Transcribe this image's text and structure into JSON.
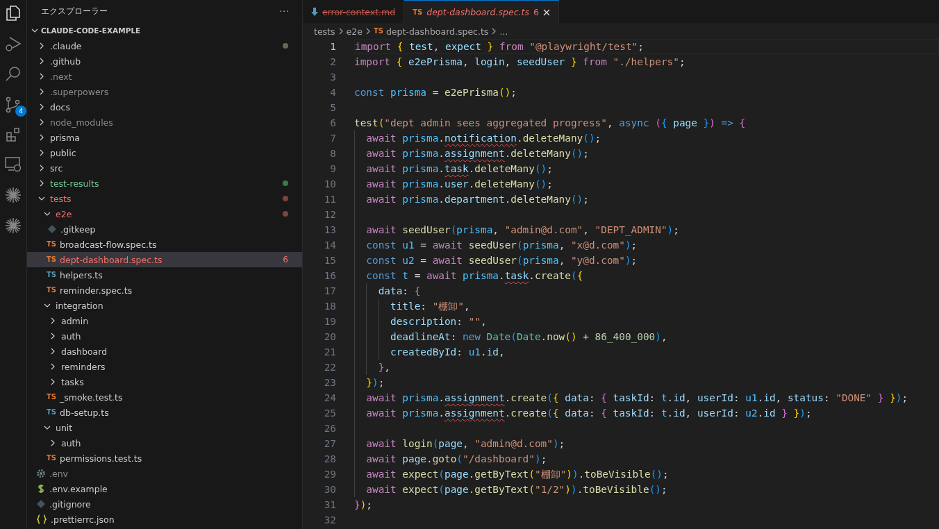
{
  "activity_bar": {
    "items": [
      {
        "kind": "explorer",
        "selected": true
      },
      {
        "kind": "debug",
        "selected": false
      },
      {
        "kind": "search",
        "selected": false
      },
      {
        "kind": "scm",
        "selected": false,
        "badge": "4"
      },
      {
        "kind": "extensions",
        "selected": false
      },
      {
        "kind": "remote",
        "selected": false
      },
      {
        "kind": "spark",
        "selected": false
      },
      {
        "kind": "spark",
        "selected": false
      }
    ]
  },
  "sidebar": {
    "title": "エクスプローラー",
    "more": "···",
    "root": {
      "label": "CLAUDE-CODE-EXAMPLE",
      "expanded": true
    },
    "items": [
      {
        "label": ".claude",
        "kind": "folder",
        "expanded": false,
        "selected": false,
        "decoration": {
          "color": "#6f6457"
        }
      },
      {
        "label": ".github",
        "kind": "folder",
        "expanded": false,
        "selected": false
      },
      {
        "label": ".next",
        "kind": "folder",
        "expanded": false,
        "selected": false,
        "color": "#8c8c8c"
      },
      {
        "label": ".superpowers",
        "kind": "folder",
        "expanded": false,
        "selected": false,
        "color": "#8c8c8c"
      },
      {
        "label": "docs",
        "kind": "folder",
        "expanded": false,
        "selected": false
      },
      {
        "label": "node_modules",
        "kind": "folder",
        "expanded": false,
        "selected": false,
        "color": "#8c8c8c"
      },
      {
        "label": "prisma",
        "kind": "folder",
        "expanded": false,
        "selected": false
      },
      {
        "label": "public",
        "kind": "folder",
        "expanded": false,
        "selected": false
      },
      {
        "label": "src",
        "kind": "folder",
        "expanded": false,
        "selected": false
      },
      {
        "label": "test-results",
        "kind": "folder",
        "expanded": false,
        "selected": false,
        "color": "#73c991",
        "decoration": {
          "color": "#3c7a4c"
        }
      },
      {
        "label": "tests",
        "kind": "folder",
        "expanded": true,
        "selected": false,
        "color": "#f2706a",
        "decoration": {
          "color": "#7a4540"
        },
        "children": [
          {
            "label": "e2e",
            "kind": "folder",
            "expanded": true,
            "selected": false,
            "color": "#f2706a",
            "decoration": {
              "color": "#7a4540"
            },
            "children": [
              {
                "label": ".gitkeep",
                "kind": "git",
                "selected": false
              },
              {
                "label": "broadcast-flow.spec.ts",
                "kind": "ts-test",
                "icon": "TS",
                "selected": false
              },
              {
                "label": "dept-dashboard.spec.ts",
                "kind": "ts-test",
                "icon": "TS",
                "selected": true,
                "color": "#f2706a",
                "badge": "6"
              },
              {
                "label": "helpers.ts",
                "kind": "ts",
                "icon": "TS",
                "selected": false
              },
              {
                "label": "reminder.spec.ts",
                "kind": "ts-test",
                "icon": "TS",
                "selected": false
              }
            ]
          },
          {
            "label": "integration",
            "kind": "folder",
            "expanded": true,
            "selected": false,
            "children": [
              {
                "label": "admin",
                "kind": "folder",
                "expanded": false,
                "selected": false
              },
              {
                "label": "auth",
                "kind": "folder",
                "expanded": false,
                "selected": false
              },
              {
                "label": "dashboard",
                "kind": "folder",
                "expanded": false,
                "selected": false
              },
              {
                "label": "reminders",
                "kind": "folder",
                "expanded": false,
                "selected": false
              },
              {
                "label": "tasks",
                "kind": "folder",
                "expanded": false,
                "selected": false
              },
              {
                "label": "_smoke.test.ts",
                "kind": "ts-test",
                "icon": "TS",
                "selected": false
              },
              {
                "label": "db-setup.ts",
                "kind": "ts",
                "icon": "TS",
                "selected": false
              }
            ]
          },
          {
            "label": "unit",
            "kind": "folder",
            "expanded": true,
            "selected": false,
            "children": [
              {
                "label": "auth",
                "kind": "folder",
                "expanded": false,
                "selected": false
              },
              {
                "label": "permissions.test.ts",
                "kind": "ts-test",
                "icon": "TS",
                "selected": false
              }
            ]
          }
        ]
      },
      {
        "label": ".env",
        "kind": "gear",
        "selected": false,
        "color": "#8c8c8c"
      },
      {
        "label": ".env.example",
        "kind": "env",
        "selected": false
      },
      {
        "label": ".gitignore",
        "kind": "git",
        "selected": false
      },
      {
        "label": ".prettierrc.json",
        "kind": "json",
        "selected": false
      }
    ]
  },
  "tabs": [
    {
      "label": "error-context.md",
      "kind": "download",
      "selected": false,
      "deleted": true,
      "preview": false
    },
    {
      "label": "dept-dashboard.spec.ts",
      "kind": "ts-test",
      "icon": "TS",
      "selected": true,
      "deleted": false,
      "preview": true,
      "problems": "6"
    }
  ],
  "breadcrumbs": [
    {
      "label": "tests"
    },
    {
      "label": "e2e"
    },
    {
      "label": "dept-dashboard.spec.ts",
      "kind": "ts-test",
      "icon": "TS"
    },
    {
      "label": "..."
    }
  ],
  "editor": {
    "lines": [
      {
        "no": "1",
        "current": true,
        "tokens": [
          {
            "kind": "kw",
            "text": "import"
          },
          {
            "kind": "b1",
            "text": " {"
          },
          {
            "kind": "var",
            "text": " test"
          },
          {
            "kind": "p",
            "text": ", "
          },
          {
            "kind": "var",
            "text": "expect"
          },
          {
            "kind": "b1",
            "text": " }"
          },
          {
            "kind": "kw",
            "text": " from"
          },
          {
            "kind": "str",
            "text": " \"@playwright/test\""
          },
          {
            "kind": "p",
            "text": ";"
          }
        ]
      },
      {
        "no": "2",
        "current": false,
        "tokens": [
          {
            "kind": "kw",
            "text": "import"
          },
          {
            "kind": "b1",
            "text": " {"
          },
          {
            "kind": "var",
            "text": " e2ePrisma"
          },
          {
            "kind": "p",
            "text": ", "
          },
          {
            "kind": "var",
            "text": "login"
          },
          {
            "kind": "p",
            "text": ", "
          },
          {
            "kind": "var",
            "text": "seedUser"
          },
          {
            "kind": "b1",
            "text": " }"
          },
          {
            "kind": "kw",
            "text": " from"
          },
          {
            "kind": "str",
            "text": " \"./helpers\""
          },
          {
            "kind": "p",
            "text": ";"
          }
        ]
      },
      {
        "no": "3",
        "current": false
      },
      {
        "no": "4",
        "current": false,
        "tokens": [
          {
            "kind": "st",
            "text": "const"
          },
          {
            "kind": "const",
            "text": " prisma"
          },
          {
            "kind": "p",
            "text": " = "
          },
          {
            "kind": "fn",
            "text": "e2ePrisma"
          },
          {
            "kind": "b1",
            "text": "()"
          },
          {
            "kind": "p",
            "text": ";"
          }
        ]
      },
      {
        "no": "5",
        "current": false
      },
      {
        "no": "6",
        "current": false,
        "tokens": [
          {
            "kind": "fn",
            "text": "test"
          },
          {
            "kind": "b1",
            "text": "("
          },
          {
            "kind": "str",
            "text": "\"dept admin sees aggregated progress\""
          },
          {
            "kind": "p",
            "text": ", "
          },
          {
            "kind": "st",
            "text": "async"
          },
          {
            "kind": "b2",
            "text": " ("
          },
          {
            "kind": "b3",
            "text": "{"
          },
          {
            "kind": "var",
            "text": " page"
          },
          {
            "kind": "b3",
            "text": " }"
          },
          {
            "kind": "b2",
            "text": ")"
          },
          {
            "kind": "st",
            "text": " =>"
          },
          {
            "kind": "b2",
            "text": " {"
          }
        ]
      },
      {
        "no": "7",
        "current": false,
        "tokens": [
          {
            "kind": "kw",
            "text": "  await"
          },
          {
            "kind": "const",
            "text": " prisma"
          },
          {
            "kind": "p",
            "text": "."
          },
          {
            "kind": "var",
            "text": "notification",
            "squiggle": true
          },
          {
            "kind": "p",
            "text": "."
          },
          {
            "kind": "fn",
            "text": "deleteMany"
          },
          {
            "kind": "b3",
            "text": "()"
          },
          {
            "kind": "p",
            "text": ";"
          }
        ]
      },
      {
        "no": "8",
        "current": false,
        "tokens": [
          {
            "kind": "kw",
            "text": "  await"
          },
          {
            "kind": "const",
            "text": " prisma"
          },
          {
            "kind": "p",
            "text": "."
          },
          {
            "kind": "var",
            "text": "assignment",
            "squiggle": true
          },
          {
            "kind": "p",
            "text": "."
          },
          {
            "kind": "fn",
            "text": "deleteMany"
          },
          {
            "kind": "b3",
            "text": "()"
          },
          {
            "kind": "p",
            "text": ";"
          }
        ]
      },
      {
        "no": "9",
        "current": false,
        "tokens": [
          {
            "kind": "kw",
            "text": "  await"
          },
          {
            "kind": "const",
            "text": " prisma"
          },
          {
            "kind": "p",
            "text": "."
          },
          {
            "kind": "var",
            "text": "task",
            "squiggle": true
          },
          {
            "kind": "p",
            "text": "."
          },
          {
            "kind": "fn",
            "text": "deleteMany"
          },
          {
            "kind": "b3",
            "text": "()"
          },
          {
            "kind": "p",
            "text": ";"
          }
        ]
      },
      {
        "no": "10",
        "current": false,
        "tokens": [
          {
            "kind": "kw",
            "text": "  await"
          },
          {
            "kind": "const",
            "text": " prisma"
          },
          {
            "kind": "p",
            "text": "."
          },
          {
            "kind": "var",
            "text": "user"
          },
          {
            "kind": "p",
            "text": "."
          },
          {
            "kind": "fn",
            "text": "deleteMany"
          },
          {
            "kind": "b3",
            "text": "()"
          },
          {
            "kind": "p",
            "text": ";"
          }
        ]
      },
      {
        "no": "11",
        "current": false,
        "tokens": [
          {
            "kind": "kw",
            "text": "  await"
          },
          {
            "kind": "const",
            "text": " prisma"
          },
          {
            "kind": "p",
            "text": "."
          },
          {
            "kind": "var",
            "text": "department"
          },
          {
            "kind": "p",
            "text": "."
          },
          {
            "kind": "fn",
            "text": "deleteMany"
          },
          {
            "kind": "b3",
            "text": "()"
          },
          {
            "kind": "p",
            "text": ";"
          }
        ]
      },
      {
        "no": "12",
        "current": false
      },
      {
        "no": "13",
        "current": false,
        "tokens": [
          {
            "kind": "kw",
            "text": "  await"
          },
          {
            "kind": "fn",
            "text": " seedUser"
          },
          {
            "kind": "b3",
            "text": "("
          },
          {
            "kind": "const",
            "text": "prisma"
          },
          {
            "kind": "p",
            "text": ", "
          },
          {
            "kind": "str",
            "text": "\"admin@d.com\""
          },
          {
            "kind": "p",
            "text": ", "
          },
          {
            "kind": "str",
            "text": "\"DEPT_ADMIN\""
          },
          {
            "kind": "b3",
            "text": ")"
          },
          {
            "kind": "p",
            "text": ";"
          }
        ]
      },
      {
        "no": "14",
        "current": false,
        "tokens": [
          {
            "kind": "st",
            "text": "  const"
          },
          {
            "kind": "const",
            "text": " u1"
          },
          {
            "kind": "p",
            "text": " = "
          },
          {
            "kind": "kw",
            "text": "await"
          },
          {
            "kind": "fn",
            "text": " seedUser"
          },
          {
            "kind": "b3",
            "text": "("
          },
          {
            "kind": "const",
            "text": "prisma"
          },
          {
            "kind": "p",
            "text": ", "
          },
          {
            "kind": "str",
            "text": "\"x@d.com\""
          },
          {
            "kind": "b3",
            "text": ")"
          },
          {
            "kind": "p",
            "text": ";"
          }
        ]
      },
      {
        "no": "15",
        "current": false,
        "tokens": [
          {
            "kind": "st",
            "text": "  const"
          },
          {
            "kind": "const",
            "text": " u2"
          },
          {
            "kind": "p",
            "text": " = "
          },
          {
            "kind": "kw",
            "text": "await"
          },
          {
            "kind": "fn",
            "text": " seedUser"
          },
          {
            "kind": "b3",
            "text": "("
          },
          {
            "kind": "const",
            "text": "prisma"
          },
          {
            "kind": "p",
            "text": ", "
          },
          {
            "kind": "str",
            "text": "\"y@d.com\""
          },
          {
            "kind": "b3",
            "text": ")"
          },
          {
            "kind": "p",
            "text": ";"
          }
        ]
      },
      {
        "no": "16",
        "current": false,
        "tokens": [
          {
            "kind": "st",
            "text": "  const"
          },
          {
            "kind": "const",
            "text": " t"
          },
          {
            "kind": "p",
            "text": " = "
          },
          {
            "kind": "kw",
            "text": "await"
          },
          {
            "kind": "const",
            "text": " prisma"
          },
          {
            "kind": "p",
            "text": "."
          },
          {
            "kind": "var",
            "text": "task",
            "squiggle": true
          },
          {
            "kind": "p",
            "text": "."
          },
          {
            "kind": "fn",
            "text": "create"
          },
          {
            "kind": "b3",
            "text": "("
          },
          {
            "kind": "b1",
            "text": "{"
          }
        ]
      },
      {
        "no": "17",
        "current": false,
        "tokens": [
          {
            "kind": "var",
            "text": "    data"
          },
          {
            "kind": "p",
            "text": ": "
          },
          {
            "kind": "b2",
            "text": "{"
          }
        ]
      },
      {
        "no": "18",
        "current": false,
        "tokens": [
          {
            "kind": "var",
            "text": "      title"
          },
          {
            "kind": "p",
            "text": ": "
          },
          {
            "kind": "str",
            "text": "\"棚卸\""
          },
          {
            "kind": "p",
            "text": ","
          }
        ]
      },
      {
        "no": "19",
        "current": false,
        "tokens": [
          {
            "kind": "var",
            "text": "      description"
          },
          {
            "kind": "p",
            "text": ": "
          },
          {
            "kind": "str",
            "text": "\"\""
          },
          {
            "kind": "p",
            "text": ","
          }
        ]
      },
      {
        "no": "20",
        "current": false,
        "tokens": [
          {
            "kind": "var",
            "text": "      deadlineAt"
          },
          {
            "kind": "p",
            "text": ": "
          },
          {
            "kind": "st",
            "text": "new"
          },
          {
            "kind": "cls",
            "text": " Date"
          },
          {
            "kind": "b3",
            "text": "("
          },
          {
            "kind": "cls",
            "text": "Date"
          },
          {
            "kind": "p",
            "text": "."
          },
          {
            "kind": "fn",
            "text": "now"
          },
          {
            "kind": "b1",
            "text": "()"
          },
          {
            "kind": "p",
            "text": " + "
          },
          {
            "kind": "num",
            "text": "86_400_000"
          },
          {
            "kind": "b3",
            "text": ")"
          },
          {
            "kind": "p",
            "text": ","
          }
        ]
      },
      {
        "no": "21",
        "current": false,
        "tokens": [
          {
            "kind": "var",
            "text": "      createdById"
          },
          {
            "kind": "p",
            "text": ": "
          },
          {
            "kind": "const",
            "text": "u1"
          },
          {
            "kind": "p",
            "text": "."
          },
          {
            "kind": "var",
            "text": "id"
          },
          {
            "kind": "p",
            "text": ","
          }
        ]
      },
      {
        "no": "22",
        "current": false,
        "tokens": [
          {
            "kind": "b2",
            "text": "    }"
          },
          {
            "kind": "p",
            "text": ","
          }
        ]
      },
      {
        "no": "23",
        "current": false,
        "tokens": [
          {
            "kind": "b1",
            "text": "  }"
          },
          {
            "kind": "b3",
            "text": ")"
          },
          {
            "kind": "p",
            "text": ";"
          }
        ]
      },
      {
        "no": "24",
        "current": false,
        "tokens": [
          {
            "kind": "kw",
            "text": "  await"
          },
          {
            "kind": "const",
            "text": " prisma"
          },
          {
            "kind": "p",
            "text": "."
          },
          {
            "kind": "var",
            "text": "assignment",
            "squiggle": true
          },
          {
            "kind": "p",
            "text": "."
          },
          {
            "kind": "fn",
            "text": "create"
          },
          {
            "kind": "b3",
            "text": "("
          },
          {
            "kind": "b1",
            "text": "{"
          },
          {
            "kind": "var",
            "text": " data"
          },
          {
            "kind": "p",
            "text": ": "
          },
          {
            "kind": "b2",
            "text": "{"
          },
          {
            "kind": "var",
            "text": " taskId"
          },
          {
            "kind": "p",
            "text": ": "
          },
          {
            "kind": "const",
            "text": "t"
          },
          {
            "kind": "p",
            "text": "."
          },
          {
            "kind": "var",
            "text": "id"
          },
          {
            "kind": "p",
            "text": ", "
          },
          {
            "kind": "var",
            "text": "userId"
          },
          {
            "kind": "p",
            "text": ": "
          },
          {
            "kind": "const",
            "text": "u1"
          },
          {
            "kind": "p",
            "text": "."
          },
          {
            "kind": "var",
            "text": "id"
          },
          {
            "kind": "p",
            "text": ", "
          },
          {
            "kind": "var",
            "text": "status"
          },
          {
            "kind": "p",
            "text": ": "
          },
          {
            "kind": "str",
            "text": "\"DONE\""
          },
          {
            "kind": "b2",
            "text": " }"
          },
          {
            "kind": "b1",
            "text": " }"
          },
          {
            "kind": "b3",
            "text": ")"
          },
          {
            "kind": "p",
            "text": ";"
          }
        ]
      },
      {
        "no": "25",
        "current": false,
        "tokens": [
          {
            "kind": "kw",
            "text": "  await"
          },
          {
            "kind": "const",
            "text": " prisma"
          },
          {
            "kind": "p",
            "text": "."
          },
          {
            "kind": "var",
            "text": "assignment",
            "squiggle": true
          },
          {
            "kind": "p",
            "text": "."
          },
          {
            "kind": "fn",
            "text": "create"
          },
          {
            "kind": "b3",
            "text": "("
          },
          {
            "kind": "b1",
            "text": "{"
          },
          {
            "kind": "var",
            "text": " data"
          },
          {
            "kind": "p",
            "text": ": "
          },
          {
            "kind": "b2",
            "text": "{"
          },
          {
            "kind": "var",
            "text": " taskId"
          },
          {
            "kind": "p",
            "text": ": "
          },
          {
            "kind": "const",
            "text": "t"
          },
          {
            "kind": "p",
            "text": "."
          },
          {
            "kind": "var",
            "text": "id"
          },
          {
            "kind": "p",
            "text": ", "
          },
          {
            "kind": "var",
            "text": "userId"
          },
          {
            "kind": "p",
            "text": ": "
          },
          {
            "kind": "const",
            "text": "u2"
          },
          {
            "kind": "p",
            "text": "."
          },
          {
            "kind": "var",
            "text": "id"
          },
          {
            "kind": "b2",
            "text": " }"
          },
          {
            "kind": "b1",
            "text": " }"
          },
          {
            "kind": "b3",
            "text": ")"
          },
          {
            "kind": "p",
            "text": ";"
          }
        ]
      },
      {
        "no": "26",
        "current": false
      },
      {
        "no": "27",
        "current": false,
        "tokens": [
          {
            "kind": "kw",
            "text": "  await"
          },
          {
            "kind": "fn",
            "text": " login"
          },
          {
            "kind": "b3",
            "text": "("
          },
          {
            "kind": "var",
            "text": "page"
          },
          {
            "kind": "p",
            "text": ", "
          },
          {
            "kind": "str",
            "text": "\"admin@d.com\""
          },
          {
            "kind": "b3",
            "text": ")"
          },
          {
            "kind": "p",
            "text": ";"
          }
        ]
      },
      {
        "no": "28",
        "current": false,
        "tokens": [
          {
            "kind": "kw",
            "text": "  await"
          },
          {
            "kind": "var",
            "text": " page"
          },
          {
            "kind": "p",
            "text": "."
          },
          {
            "kind": "fn",
            "text": "goto"
          },
          {
            "kind": "b3",
            "text": "("
          },
          {
            "kind": "str",
            "text": "\"/dashboard\""
          },
          {
            "kind": "b3",
            "text": ")"
          },
          {
            "kind": "p",
            "text": ";"
          }
        ]
      },
      {
        "no": "29",
        "current": false,
        "tokens": [
          {
            "kind": "kw",
            "text": "  await"
          },
          {
            "kind": "fn",
            "text": " expect"
          },
          {
            "kind": "b3",
            "text": "("
          },
          {
            "kind": "var",
            "text": "page"
          },
          {
            "kind": "p",
            "text": "."
          },
          {
            "kind": "fn",
            "text": "getByText"
          },
          {
            "kind": "b1",
            "text": "("
          },
          {
            "kind": "str",
            "text": "\"棚卸\""
          },
          {
            "kind": "b1",
            "text": ")"
          },
          {
            "kind": "b3",
            "text": ")"
          },
          {
            "kind": "p",
            "text": "."
          },
          {
            "kind": "fn",
            "text": "toBeVisible"
          },
          {
            "kind": "b3",
            "text": "()"
          },
          {
            "kind": "p",
            "text": ";"
          }
        ]
      },
      {
        "no": "30",
        "current": false,
        "tokens": [
          {
            "kind": "kw",
            "text": "  await"
          },
          {
            "kind": "fn",
            "text": " expect"
          },
          {
            "kind": "b3",
            "text": "("
          },
          {
            "kind": "var",
            "text": "page"
          },
          {
            "kind": "p",
            "text": "."
          },
          {
            "kind": "fn",
            "text": "getByText"
          },
          {
            "kind": "b1",
            "text": "("
          },
          {
            "kind": "str",
            "text": "\"1/2\""
          },
          {
            "kind": "b1",
            "text": ")"
          },
          {
            "kind": "b3",
            "text": ")"
          },
          {
            "kind": "p",
            "text": "."
          },
          {
            "kind": "fn",
            "text": "toBeVisible"
          },
          {
            "kind": "b3",
            "text": "()"
          },
          {
            "kind": "p",
            "text": ";"
          }
        ]
      },
      {
        "no": "31",
        "current": false,
        "tokens": [
          {
            "kind": "b2",
            "text": "}"
          },
          {
            "kind": "b1",
            "text": ")"
          },
          {
            "kind": "p",
            "text": ";"
          }
        ]
      },
      {
        "no": "32",
        "current": false
      }
    ]
  }
}
